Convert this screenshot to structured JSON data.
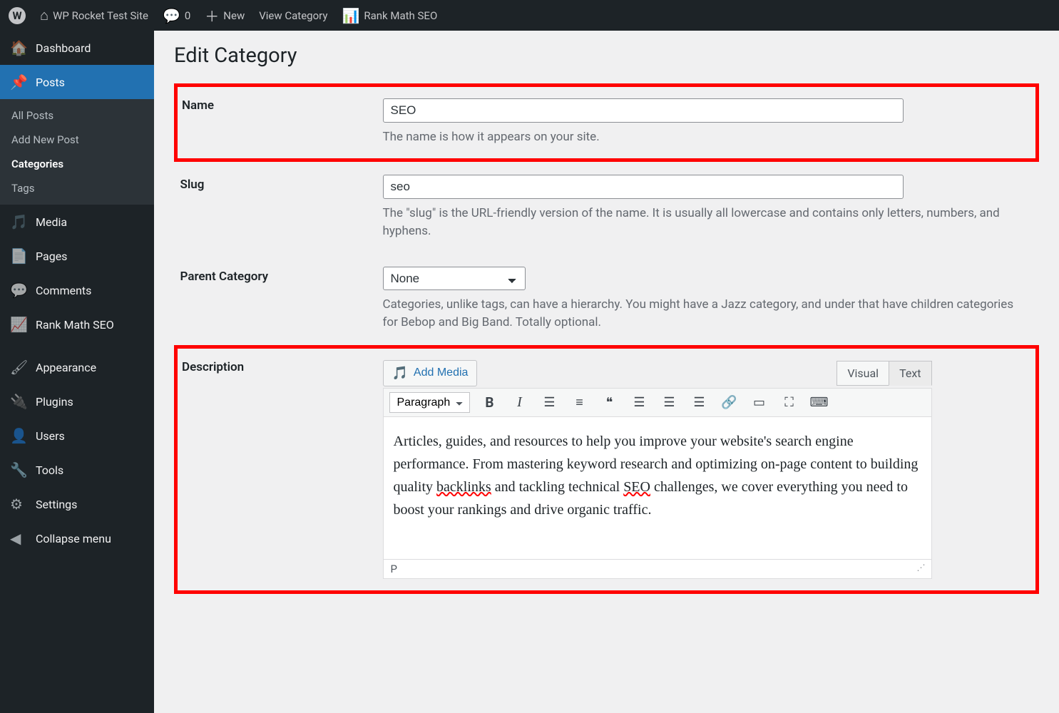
{
  "topbar": {
    "site_name": "WP Rocket Test Site",
    "comment_count": "0",
    "new_label": "New",
    "view_label": "View Category",
    "seo_label": "Rank Math SEO"
  },
  "sidebar": {
    "dashboard": "Dashboard",
    "posts": "Posts",
    "posts_sub": {
      "all": "All Posts",
      "add": "Add New Post",
      "categories": "Categories",
      "tags": "Tags"
    },
    "media": "Media",
    "pages": "Pages",
    "comments": "Comments",
    "rankmath": "Rank Math SEO",
    "appearance": "Appearance",
    "plugins": "Plugins",
    "users": "Users",
    "tools": "Tools",
    "settings": "Settings",
    "collapse": "Collapse menu"
  },
  "page": {
    "title": "Edit Category",
    "name": {
      "label": "Name",
      "value": "SEO",
      "hint": "The name is how it appears on your site."
    },
    "slug": {
      "label": "Slug",
      "value": "seo",
      "hint": "The \"slug\" is the URL-friendly version of the name. It is usually all lowercase and contains only letters, numbers, and hyphens."
    },
    "parent": {
      "label": "Parent Category",
      "value": "None",
      "hint": "Categories, unlike tags, can have a hierarchy. You might have a Jazz category, and under that have children categories for Bebop and Big Band. Totally optional."
    },
    "description": {
      "label": "Description",
      "add_media": "Add Media",
      "tab_visual": "Visual",
      "tab_text": "Text",
      "format": "Paragraph",
      "content_pre": "Articles, guides, and resources to help you improve your website's search engine performance. From mastering keyword research and optimizing on-page content to building quality ",
      "content_sp1": "backlinks",
      "content_mid": " and tackling technical ",
      "content_sp2": "SEO",
      "content_post": " challenges, we cover everything you need to boost your rankings and drive organic traffic.",
      "status_path": "P"
    }
  }
}
